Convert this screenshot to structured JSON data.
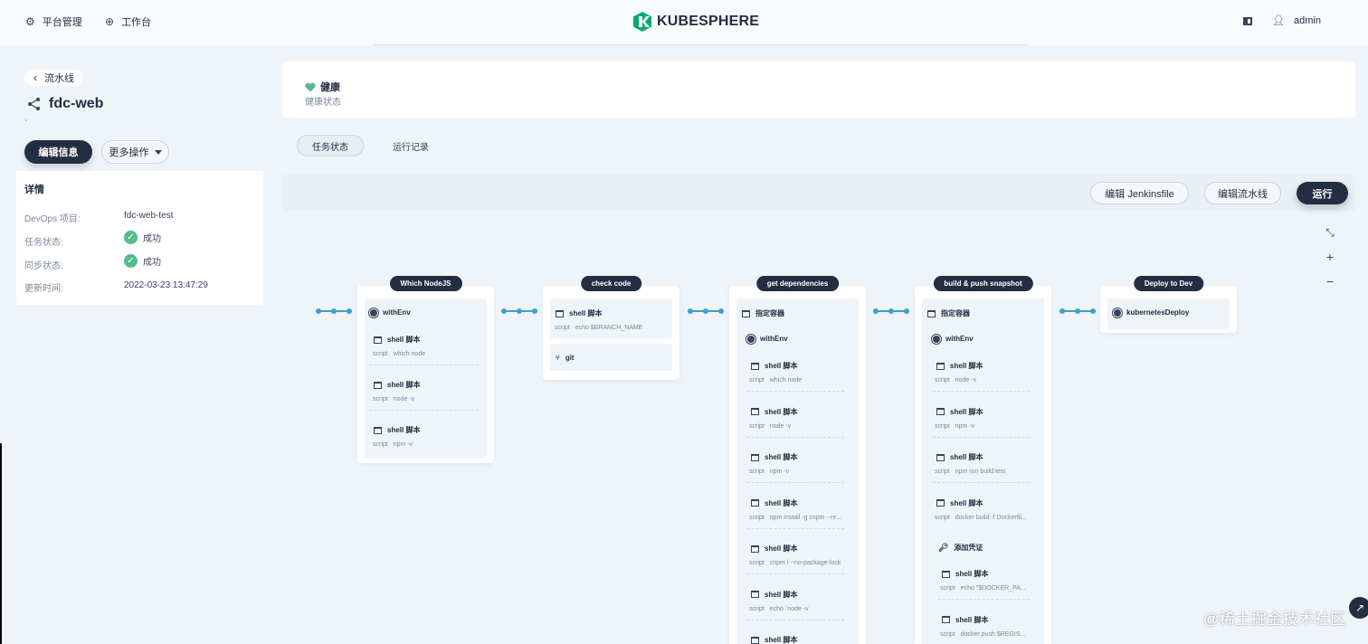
{
  "topbar": {
    "platform_label": "平台管理",
    "workbench_label": "工作台",
    "logo_text": "KUBESPHERE",
    "user_name": "admin"
  },
  "sidebar": {
    "back_label": "流水线",
    "pipeline_name": "fdc-web",
    "description": "-",
    "edit_button": "编辑信息",
    "more_button": "更多操作",
    "details_title": "详情",
    "details": [
      {
        "label": "DevOps 项目:",
        "value": "fdc-web-test"
      },
      {
        "label": "任务状态:",
        "value": "成功"
      },
      {
        "label": "同步状态:",
        "value": "成功"
      },
      {
        "label": "更新时间:",
        "value": "2022-03-23 13:47:29"
      }
    ]
  },
  "health": {
    "title": "健康",
    "subtitle": "健康状态",
    "color": "#55bc8a"
  },
  "tabs": [
    {
      "label": "任务状态",
      "active": true
    },
    {
      "label": "运行记录",
      "active": false
    }
  ],
  "toolbar": {
    "edit_jenkinsfile": "编辑 Jenkinsfile",
    "edit_pipeline": "编辑流水线",
    "run": "运行"
  },
  "zoom": {
    "fit": "⤡",
    "in": "+",
    "out": "−"
  },
  "stages": [
    {
      "name": "Which NodeJS",
      "withenv": "withEnv",
      "steps": [
        {
          "title": "shell 脚本",
          "key": "script",
          "val": "which node"
        },
        {
          "title": "shell 脚本",
          "key": "script",
          "val": "node -v"
        },
        {
          "title": "shell 脚本",
          "key": "script",
          "val": "npm -v"
        }
      ]
    },
    {
      "name": "check code",
      "steps": [
        {
          "title": "shell 脚本",
          "key": "script",
          "val": "echo $BRANCH_NAME"
        }
      ],
      "git": "git"
    },
    {
      "name": "get dependencies",
      "container": "指定容器",
      "withenv": "withEnv",
      "steps": [
        {
          "title": "shell 脚本",
          "key": "script",
          "val": "which node"
        },
        {
          "title": "shell 脚本",
          "key": "script",
          "val": "node -v"
        },
        {
          "title": "shell 脚本",
          "key": "script",
          "val": "npm -v"
        },
        {
          "title": "shell 脚本",
          "key": "script",
          "val": "npm install -g cnpm --re..."
        },
        {
          "title": "shell 脚本",
          "key": "script",
          "val": "cnpm i --no-package-lock"
        },
        {
          "title": "shell 脚本",
          "key": "script",
          "val": "echo `node -v`"
        },
        {
          "title": "shell 脚本"
        }
      ]
    },
    {
      "name": "build & push snapshot",
      "container": "指定容器",
      "withenv": "withEnv",
      "steps": [
        {
          "title": "shell 脚本",
          "key": "script",
          "val": "node -v"
        },
        {
          "title": "shell 脚本",
          "key": "script",
          "val": "npm -v"
        },
        {
          "title": "shell 脚本",
          "key": "script",
          "val": "npm run build:test"
        },
        {
          "title": "shell 脚本",
          "key": "script",
          "val": "docker build -f Dockerfil..."
        }
      ],
      "credential": "添加凭证",
      "cred_steps": [
        {
          "title": "shell 脚本",
          "key": "script",
          "val": "echo \"$DOCKER_PA..."
        },
        {
          "title": "shell 脚本",
          "key": "script",
          "val": "docker push $REGIS..."
        }
      ]
    },
    {
      "name": "Deploy to Dev",
      "deploy": "kubernetesDeploy"
    }
  ],
  "watermark": "@稀土掘金技术社区"
}
